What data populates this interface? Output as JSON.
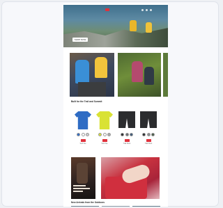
{
  "hero": {
    "button_label": "SHOP NOW"
  },
  "sections": {
    "featured_title": "Built for the Trail and Summit",
    "promo_title": "New Arrivals from the Outdoors"
  },
  "products": [
    {
      "name": "Tech Tee",
      "color": "#2f6cc4",
      "swatches": [
        "#2f6cc4",
        "#ffffff",
        "#cccccc"
      ]
    },
    {
      "name": "Tech Tee",
      "color": "#d9e234",
      "swatches": [
        "#d9e234",
        "#ffffff",
        "#aaaaaa"
      ]
    },
    {
      "name": "Trail Short",
      "color": "#2b2c2e",
      "swatches": [
        "#2b2c2e",
        "#6b6e72",
        "#3e5a7a"
      ]
    },
    {
      "name": "Trail Short",
      "color": "#2b2c2e",
      "swatches": [
        "#2b2c2e",
        "#8a8d90",
        "#4b5d4a"
      ]
    }
  ],
  "colors": {
    "accent": "#e0313c",
    "page_bg": "#ffffff",
    "frame_bg": "#f7f8fb"
  }
}
